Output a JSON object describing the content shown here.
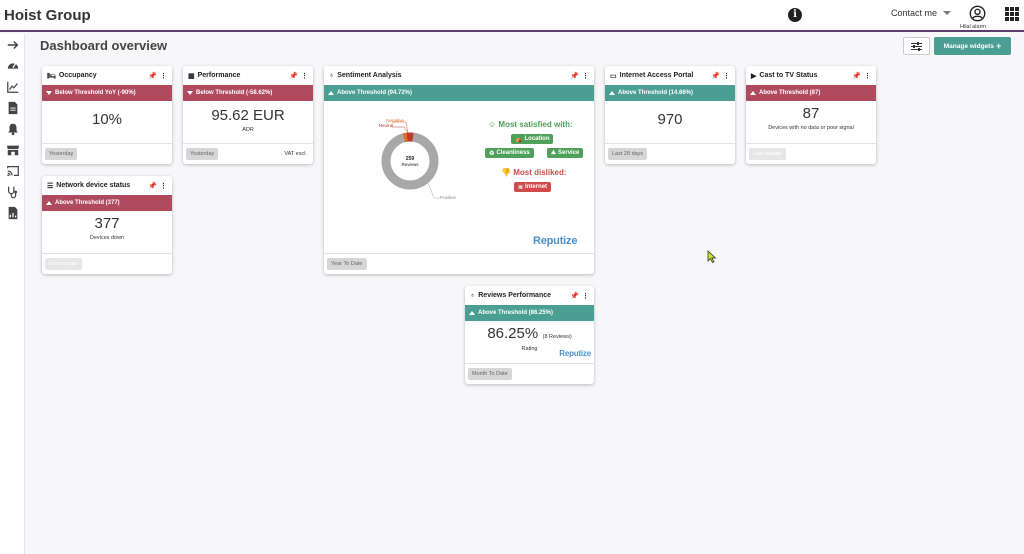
{
  "app": {
    "brand": "Hoist Group",
    "contact_label": "Contact me",
    "user_name": "Hilal alarm"
  },
  "page": {
    "title": "Dashboard overview",
    "manage_widgets_label": "Manage widgets"
  },
  "sidebar": {
    "items": [
      {
        "icon": "arrow-right-icon"
      },
      {
        "icon": "speedometer-icon"
      },
      {
        "icon": "line-chart-icon"
      },
      {
        "icon": "document-icon"
      },
      {
        "icon": "bell-icon"
      },
      {
        "icon": "store-icon"
      },
      {
        "icon": "cast-icon"
      },
      {
        "icon": "stethoscope-icon"
      },
      {
        "icon": "report-icon"
      }
    ]
  },
  "widgets": {
    "occupancy": {
      "title": "Occupancy",
      "band": "Below Threshold YoY (-90%)",
      "value": "10%",
      "period": "Yesterday"
    },
    "performance": {
      "title": "Performance",
      "band": "Below Threshold (-58.62%)",
      "value": "95.62 EUR",
      "sub": "ADR",
      "period": "Yesterday",
      "note": "VAT excl."
    },
    "sentiment": {
      "title": "Sentiment Analysis",
      "band": "Above Threshold (94.72%)",
      "donut_center_value": "259",
      "donut_center_label": "Reviews",
      "label_negative": "Negative",
      "label_neutral": "Neutral",
      "label_positive": "Positive",
      "most_satisfied": "Most satisfied with:",
      "satisfied_chips": [
        "Location",
        "Cleanliness",
        "Service"
      ],
      "most_disliked": "Most disliked:",
      "disliked_chips": [
        "Internet"
      ],
      "brand": "Reputize",
      "period": "Year To Date",
      "colors": {
        "positive": "#a8a8a8",
        "negative": "#e36b1c",
        "neutral": "#c0392b"
      }
    },
    "internet_access": {
      "title": "Internet Access Portal",
      "band": "Above Threshold (14.66%)",
      "value": "970",
      "period": "Last 28 days"
    },
    "cast_tv": {
      "title": "Cast to TV Status",
      "band": "Above Threshold (87)",
      "value": "87",
      "sub": "Devices with no data or poor signal",
      "period": "Last update"
    },
    "network": {
      "title": "Network device status",
      "band": "Above Threshold (377)",
      "value": "377",
      "sub": "Devices down",
      "period": "Last update"
    },
    "reviews": {
      "title": "Reviews Performance",
      "band": "Above Threshold (86.25%)",
      "value": "86.25%",
      "count": "(8 Reviews)",
      "sub": "Rating",
      "brand": "Reputize",
      "period": "Month To Date"
    }
  },
  "colors": {
    "accent": "#5b3e6e",
    "teal": "#4a9e92",
    "red_band": "#b04a5e",
    "green_chip": "#4fa05a",
    "red_chip": "#d04b4b"
  }
}
